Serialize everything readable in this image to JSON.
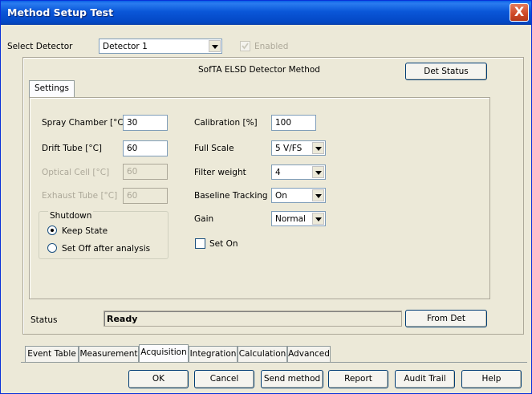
{
  "window": {
    "title": "Method Setup Test",
    "close_label": "X"
  },
  "detector": {
    "label": "Select Detector",
    "selected": "Detector 1",
    "enabled_label": "Enabled"
  },
  "method_title": "SofTA ELSD Detector Method",
  "det_status_label": "Det Status",
  "settings_tab": "Settings",
  "fields": {
    "spray_chamber": {
      "label": "Spray Chamber [°C]",
      "value": "30"
    },
    "drift_tube": {
      "label": "Drift Tube [°C]",
      "value": "60"
    },
    "optical_cell": {
      "label": "Optical Cell [°C]",
      "value": "60"
    },
    "exhaust_tube": {
      "label": "Exhaust Tube [°C]",
      "value": "60"
    },
    "calibration": {
      "label": "Calibration [%]",
      "value": "100"
    },
    "full_scale": {
      "label": "Full Scale",
      "value": "5 V/FS"
    },
    "filter_weight": {
      "label": "Filter weight",
      "value": "4"
    },
    "baseline_tracking": {
      "label": "Baseline Tracking",
      "value": "On"
    },
    "gain": {
      "label": "Gain",
      "value": "Normal"
    },
    "set_on": {
      "label": "Set On"
    }
  },
  "shutdown": {
    "legend": "Shutdown",
    "keep_state": "Keep State",
    "set_off": "Set Off after analysis"
  },
  "status": {
    "label": "Status",
    "value": "Ready",
    "from_det_label": "From Det"
  },
  "bottom_tabs": [
    "Event Table",
    "Measurement",
    "Acquisition",
    "Integration",
    "Calculation",
    "Advanced"
  ],
  "active_bottom_tab": "Acquisition",
  "buttons": {
    "ok": "OK",
    "cancel": "Cancel",
    "send_method": "Send method",
    "report": "Report",
    "audit_trail": "Audit Trail",
    "help": "Help"
  }
}
